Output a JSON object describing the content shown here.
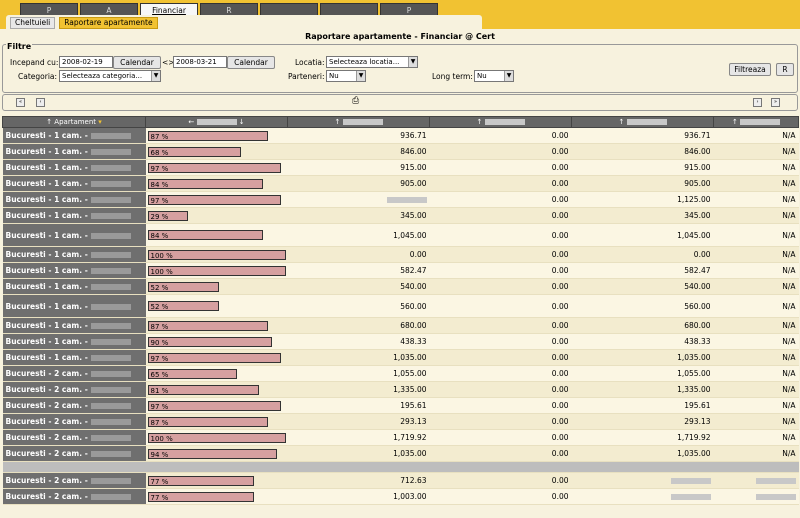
{
  "top_tabs": [
    "P",
    "A",
    "Financiar",
    "R",
    "",
    "",
    "P"
  ],
  "active_top_tab": 2,
  "sub_tabs": [
    "Cheltuieli",
    "Raportare apartamente"
  ],
  "page_title": "Raportare apartamente - Financiar @ Cert",
  "filters": {
    "legend": "Filtre",
    "start_label": "Incepand cu:",
    "start_value": "2008-02-19",
    "calendar_label": "Calendar",
    "arrow": "<>",
    "end_value": "2008-03-21",
    "location_label": "Locatia:",
    "location_value": "Selecteaza locatia...",
    "category_label": "Categoria:",
    "category_value": "Selecteaza categoria...",
    "partners_label": "Parteneri:",
    "partners_value": "Nu",
    "longterm_label": "Long term:",
    "longterm_value": "Nu",
    "filter_button": "Filtreaza",
    "reset_button": "R"
  },
  "table": {
    "headers": [
      "Apartament",
      "",
      "",
      "",
      "",
      ""
    ],
    "rows": [
      {
        "name": "Bucuresti - 1 cam. -",
        "pct": 87,
        "pct_label": "87 %",
        "v1": "936.71",
        "v2": "0.00",
        "v3": "936.71",
        "v4": "N/A"
      },
      {
        "name": "Bucuresti - 1 cam. -",
        "pct": 68,
        "pct_label": "68 %",
        "v1": "846.00",
        "v2": "0.00",
        "v3": "846.00",
        "v4": "N/A"
      },
      {
        "name": "Bucuresti - 1 cam. -",
        "pct": 97,
        "pct_label": "97 %",
        "v1": "915.00",
        "v2": "0.00",
        "v3": "915.00",
        "v4": "N/A"
      },
      {
        "name": "Bucuresti - 1 cam. -",
        "pct": 84,
        "pct_label": "84 %",
        "v1": "905.00",
        "v2": "0.00",
        "v3": "905.00",
        "v4": "N/A"
      },
      {
        "name": "Bucuresti - 1 cam. -",
        "pct": 97,
        "pct_label": "97 %",
        "v1": "",
        "v2": "0.00",
        "v3": "1,125.00",
        "v4": "N/A"
      },
      {
        "name": "Bucuresti - 1 cam. -",
        "pct": 29,
        "pct_label": "29 %",
        "v1": "345.00",
        "v2": "0.00",
        "v3": "345.00",
        "v4": "N/A"
      },
      {
        "name": "Bucuresti - 1 cam. -",
        "pct": 84,
        "pct_label": "84 %",
        "v1": "1,045.00",
        "v2": "0.00",
        "v3": "1,045.00",
        "v4": "N/A",
        "tall": true
      },
      {
        "name": "Bucuresti - 1 cam. -",
        "pct": 100,
        "pct_label": "100 %",
        "v1": "0.00",
        "v2": "0.00",
        "v3": "0.00",
        "v4": "N/A"
      },
      {
        "name": "Bucuresti - 1 cam. -",
        "pct": 100,
        "pct_label": "100 %",
        "v1": "582.47",
        "v2": "0.00",
        "v3": "582.47",
        "v4": "N/A"
      },
      {
        "name": "Bucuresti - 1 cam. -",
        "pct": 52,
        "pct_label": "52 %",
        "v1": "540.00",
        "v2": "0.00",
        "v3": "540.00",
        "v4": "N/A"
      },
      {
        "name": "Bucuresti - 1 cam. -",
        "pct": 52,
        "pct_label": "52 %",
        "v1": "560.00",
        "v2": "0.00",
        "v3": "560.00",
        "v4": "N/A",
        "tall": true
      },
      {
        "name": "Bucuresti - 1 cam. -",
        "pct": 87,
        "pct_label": "87 %",
        "v1": "680.00",
        "v2": "0.00",
        "v3": "680.00",
        "v4": "N/A"
      },
      {
        "name": "Bucuresti - 1 cam. -",
        "pct": 90,
        "pct_label": "90 %",
        "v1": "438.33",
        "v2": "0.00",
        "v3": "438.33",
        "v4": "N/A"
      },
      {
        "name": "Bucuresti - 1 cam. -",
        "pct": 97,
        "pct_label": "97 %",
        "v1": "1,035.00",
        "v2": "0.00",
        "v3": "1,035.00",
        "v4": "N/A"
      },
      {
        "name": "Bucuresti - 2 cam. -",
        "pct": 65,
        "pct_label": "65 %",
        "v1": "1,055.00",
        "v2": "0.00",
        "v3": "1,055.00",
        "v4": "N/A"
      },
      {
        "name": "Bucuresti - 2 cam. -",
        "pct": 81,
        "pct_label": "81 %",
        "v1": "1,335.00",
        "v2": "0.00",
        "v3": "1,335.00",
        "v4": "N/A"
      },
      {
        "name": "Bucuresti - 2 cam. -",
        "pct": 97,
        "pct_label": "97 %",
        "v1": "195.61",
        "v2": "0.00",
        "v3": "195.61",
        "v4": "N/A"
      },
      {
        "name": "Bucuresti - 2 cam. -",
        "pct": 87,
        "pct_label": "87 %",
        "v1": "293.13",
        "v2": "0.00",
        "v3": "293.13",
        "v4": "N/A"
      },
      {
        "name": "Bucuresti - 2 cam. -",
        "pct": 100,
        "pct_label": "100 %",
        "v1": "1,719.92",
        "v2": "0.00",
        "v3": "1,719.92",
        "v4": "N/A"
      },
      {
        "name": "Bucuresti - 2 cam. -",
        "pct": 94,
        "pct_label": "94 %",
        "v1": "1,035.00",
        "v2": "0.00",
        "v3": "1,035.00",
        "v4": "N/A"
      },
      {
        "separator": true
      },
      {
        "name": "Bucuresti - 2 cam. -",
        "pct": 77,
        "pct_label": "77 %",
        "v1": "712.63",
        "v2": "0.00",
        "v3": "",
        "v4": ""
      },
      {
        "name": "Bucuresti - 2 cam. -",
        "pct": 77,
        "pct_label": "77 %",
        "v1": "1,003.00",
        "v2": "0.00",
        "v3": "",
        "v4": ""
      }
    ]
  }
}
